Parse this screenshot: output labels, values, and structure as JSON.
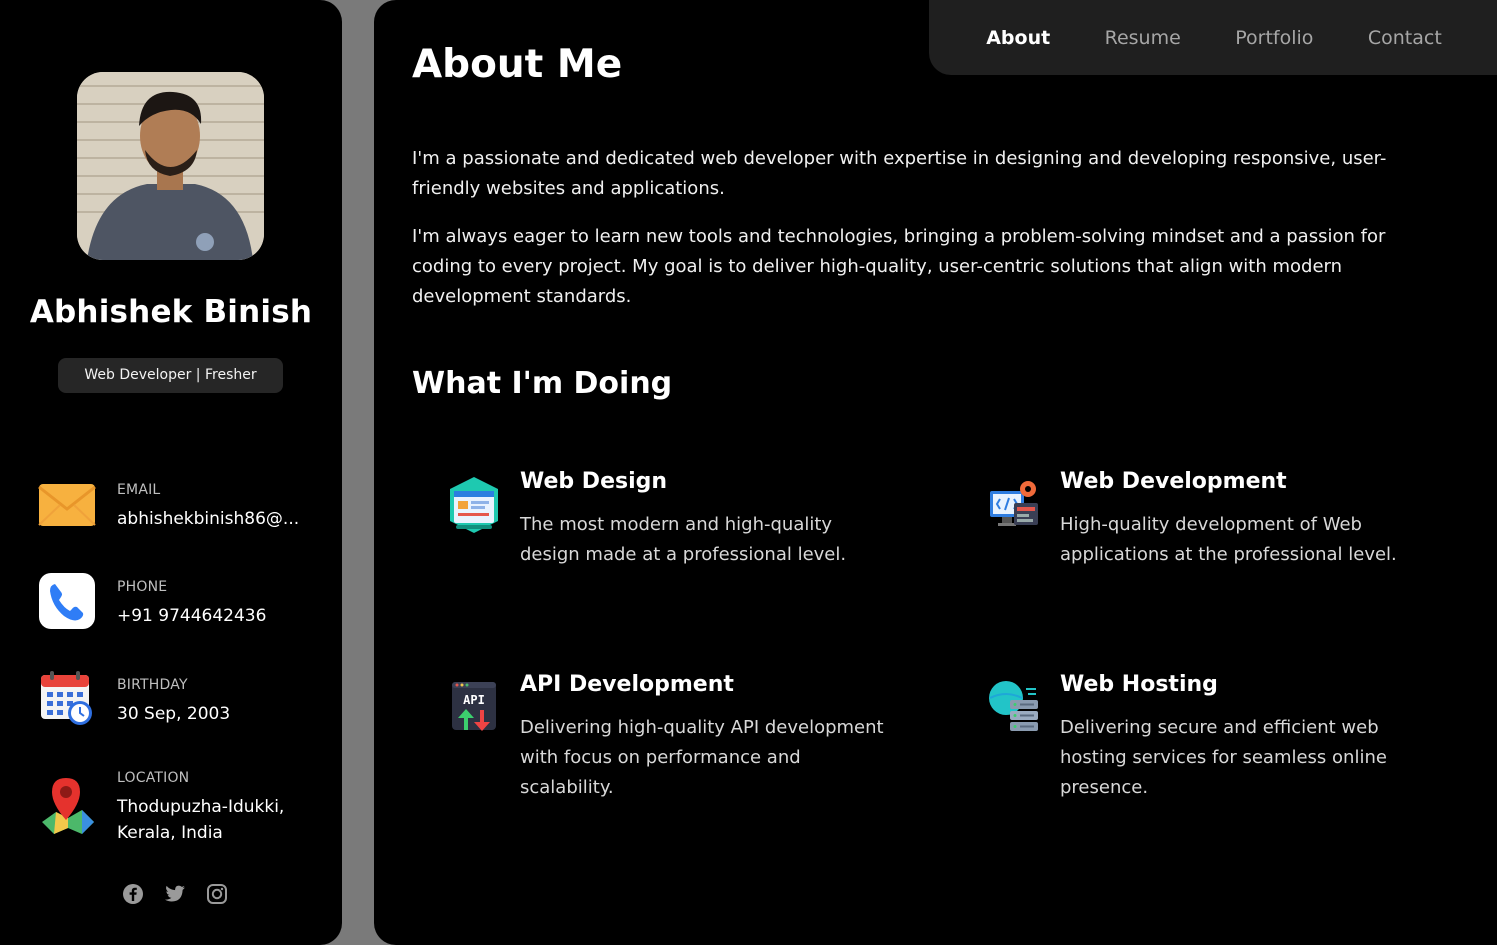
{
  "profile": {
    "name": "Abhishek Binish",
    "role": "Web Developer | Fresher"
  },
  "contacts": [
    {
      "label": "EMAIL",
      "value": "abhishekbinish86@...",
      "icon": "mail-icon"
    },
    {
      "label": "PHONE",
      "value": "+91 9744642436",
      "icon": "phone-icon"
    },
    {
      "label": "BIRTHDAY",
      "value": "30 Sep, 2003",
      "icon": "calendar-icon"
    },
    {
      "label": "LOCATION",
      "value": "Thodupuzha-Idukki, Kerala, India",
      "icon": "map-pin-icon"
    }
  ],
  "socials": [
    "facebook-icon",
    "twitter-icon",
    "instagram-icon"
  ],
  "nav": {
    "items": [
      "About",
      "Resume",
      "Portfolio",
      "Contact"
    ],
    "active": "About"
  },
  "about": {
    "title": "About Me",
    "paragraphs": [
      "I'm a passionate and dedicated web developer with expertise in designing and developing responsive, user-friendly websites and applications.",
      "I'm always eager to learn new tools and technologies, bringing a problem-solving mindset and a passion for coding to every project. My goal is to deliver high-quality, user-centric solutions that align with modern development standards."
    ]
  },
  "services": {
    "title": "What I'm Doing",
    "items": [
      {
        "name": "Web Design",
        "desc": "The most modern and high-quality design made at a professional level.",
        "icon": "web-design-icon"
      },
      {
        "name": "Web Development",
        "desc": "High-quality development of Web applications at the professional level.",
        "icon": "web-development-icon"
      },
      {
        "name": "API Development",
        "desc": "Delivering high-quality API development with focus on performance and scalability.",
        "icon": "api-icon",
        "icon_text": "API"
      },
      {
        "name": "Web Hosting",
        "desc": "Delivering secure and efficient web hosting services for seamless online presence.",
        "icon": "server-icon"
      }
    ]
  },
  "colors": {
    "background": "#000000",
    "navbar": "#1f1f1f",
    "badge": "#262626",
    "muted": "#a6a6a6"
  }
}
